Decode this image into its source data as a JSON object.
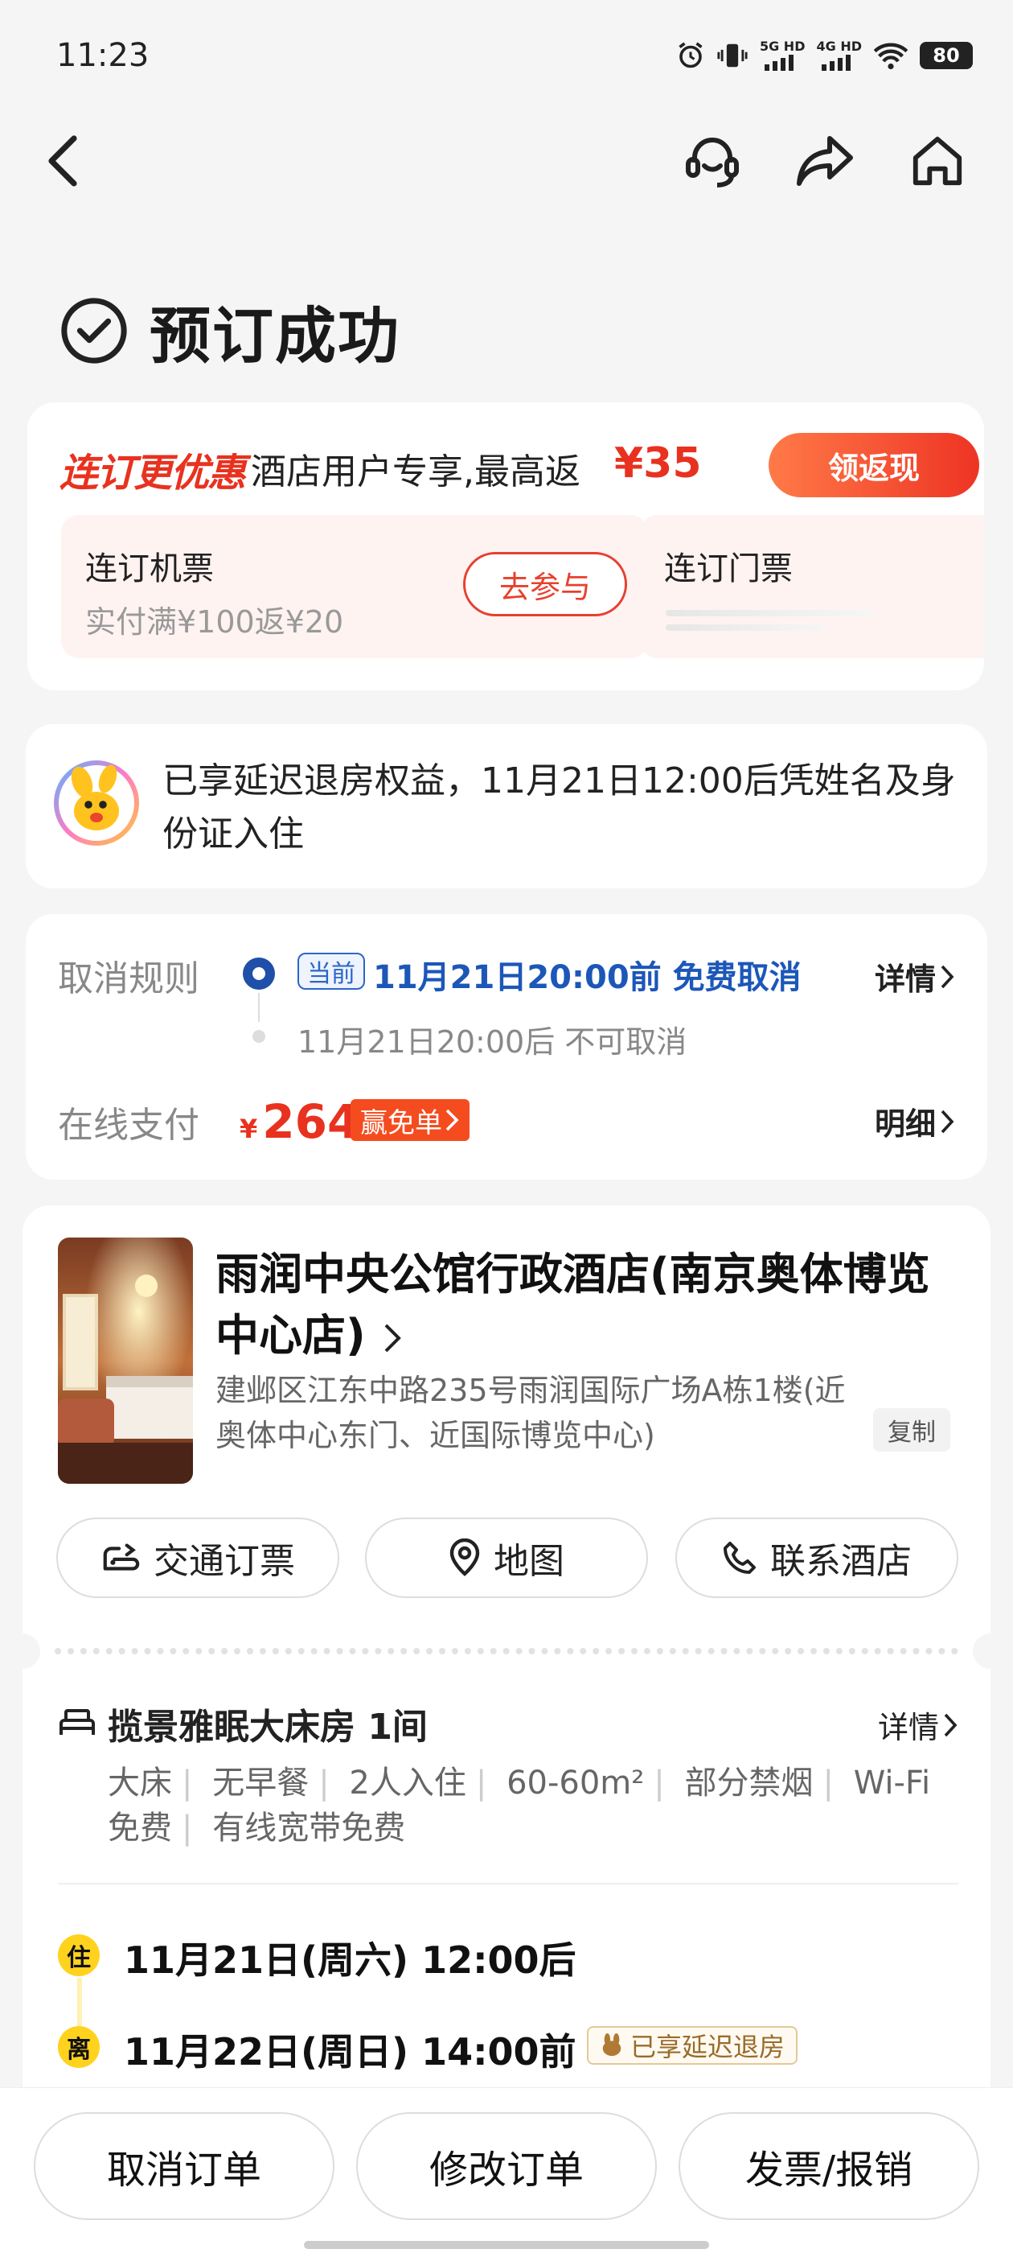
{
  "status_bar": {
    "time": "11:23",
    "net1": "5G HD",
    "net2": "4G HD",
    "battery": "80"
  },
  "nav": {
    "icons": [
      "back-arrow-icon",
      "customer-service-icon",
      "share-icon",
      "home-icon"
    ]
  },
  "page": {
    "title": "预订成功"
  },
  "promo": {
    "brand": "连订更优惠",
    "text": "酒店用户专享,最高返",
    "amount": "¥35",
    "cta": "领返现",
    "items": [
      {
        "title": "连订机票",
        "desc": "实付满¥100返¥20",
        "cta": "去参与"
      },
      {
        "title": "连订门票"
      }
    ]
  },
  "late_checkout": {
    "text": "已享延迟退房权益，11月21日12:00后凭姓名及身份证入住"
  },
  "cancel": {
    "label": "取消规则",
    "current_badge": "当前",
    "current_text": "11月21日20:00前 免费取消",
    "after_text": "11月21日20:00后 不可取消",
    "detail": "详情",
    "pay_label": "在线支付",
    "currency": "¥",
    "amount": "264",
    "win_badge": "赢免单",
    "breakdown": "明细"
  },
  "hotel": {
    "name": "雨润中央公馆行政酒店(南京奥体博览中心店)",
    "address": "建邺区江东中路235号雨润国际广场A栋1楼(近奥体中心东门、近国际博览中心)",
    "copy": "复制",
    "actions": [
      {
        "label": "交通订票",
        "icon": "transport-icon"
      },
      {
        "label": "地图",
        "icon": "map-pin-icon"
      },
      {
        "label": "联系酒店",
        "icon": "phone-icon"
      }
    ]
  },
  "room": {
    "title": "揽景雅眠大床房 1间",
    "detail": "详情",
    "amenities": [
      "大床",
      "无早餐",
      "2人入住",
      "60-60m²",
      "部分禁烟",
      "Wi-Fi免费",
      "有线宽带免费"
    ],
    "checkin_badge": "住",
    "checkin": "11月21日(周六) 12:00后",
    "checkout_badge": "离",
    "checkout": "11月22日(周日) 14:00前",
    "late_tag": "已享延迟退房"
  },
  "bottom": {
    "cancel": "取消订单",
    "modify": "修改订单",
    "invoice": "发票/报销"
  },
  "colors": {
    "accent_red": "#e8321f",
    "link_blue": "#1c57b8",
    "yellow": "#ffd21e"
  }
}
